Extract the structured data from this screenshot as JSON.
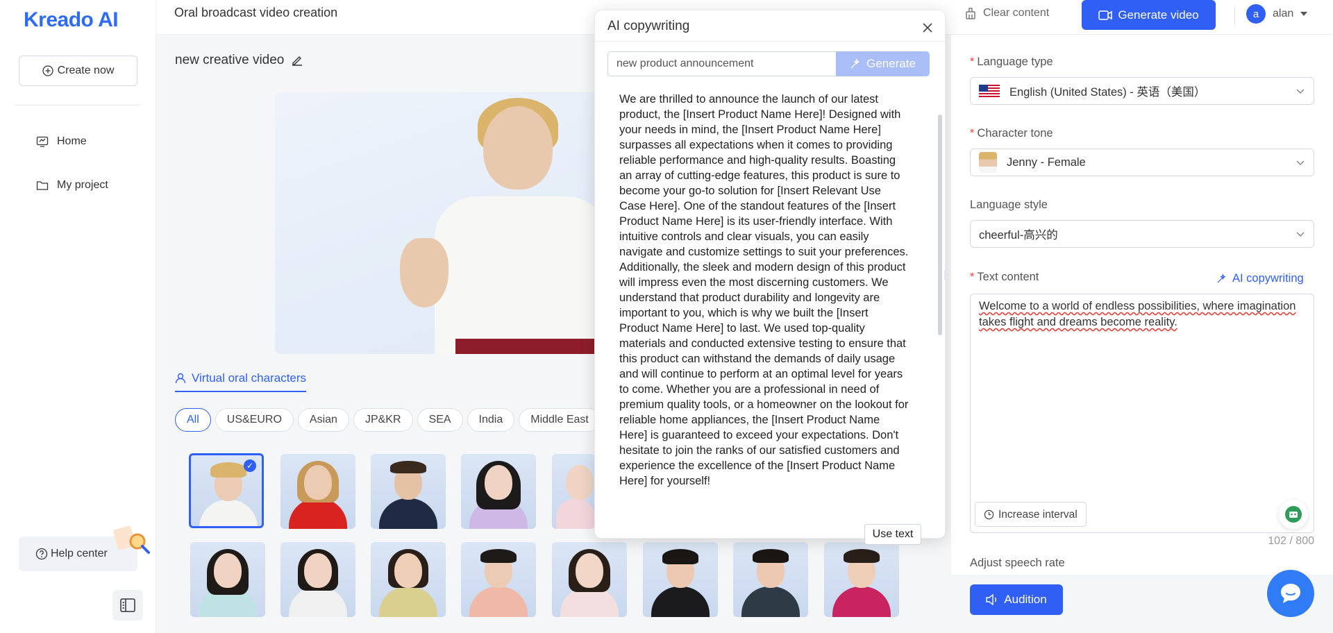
{
  "sidebar": {
    "logo": "Kreado AI",
    "create_label": "Create now",
    "nav": [
      {
        "label": "Home",
        "icon": "home-icon"
      },
      {
        "label": "My project",
        "icon": "folder-icon"
      }
    ],
    "help_label": "Help center"
  },
  "header": {
    "title": "Oral broadcast video creation",
    "clear_label": "Clear content",
    "generate_label": "Generate video",
    "user_initial": "a",
    "user_name": "alan"
  },
  "main": {
    "video_name": "new creative video",
    "tab_label": "Virtual oral characters",
    "filters": [
      "All",
      "US&EURO",
      "Asian",
      "JP&KR",
      "SEA",
      "India",
      "Middle East"
    ],
    "active_filter": "All"
  },
  "popup": {
    "title": "AI copywriting",
    "prompt_value": "new product announcement",
    "generate_label": "Generate",
    "generated_text": "We are thrilled to announce the launch of our latest product, the [Insert Product Name Here]! Designed with your needs in mind, the [Insert Product Name Here] surpasses all expectations when it comes to providing reliable performance and high-quality results. Boasting an array of cutting-edge features, this product is sure to become your go-to solution for [Insert Relevant Use Case Here]. One of the standout features of the [Insert Product Name Here] is its user-friendly interface. With intuitive controls and clear visuals, you can easily navigate and customize settings to suit your preferences. Additionally, the sleek and modern design of this product will impress even the most discerning customers. We understand that product durability and longevity are important to you, which is why we built the [Insert Product Name Here] to last. We used top-quality materials and conducted extensive testing to ensure that this product can withstand the demands of daily usage and will continue to perform at an optimal level for years to come. Whether you are a professional in need of premium quality tools, or a homeowner on the lookout for reliable home appliances, the [Insert Product Name Here] is guaranteed to exceed your expectations. Don't hesitate to join the ranks of our satisfied customers and experience the excellence of the [Insert Product Name Here] for yourself!",
    "use_text_label": "Use text"
  },
  "settings": {
    "language_type_label": "Language type",
    "language_type_value": "English (United States) - 英语（美国）",
    "character_tone_label": "Character tone",
    "character_tone_value": "Jenny - Female",
    "language_style_label": "Language style",
    "language_style_value": "cheerful-高兴的",
    "text_content_label": "Text content",
    "ai_copy_link": "AI copywriting",
    "text_content_value": "Welcome to a world of endless possibilities, where imagination takes flight and dreams become reality.",
    "interval_label": "Increase interval",
    "counter": "102 / 800",
    "speech_rate_label": "Adjust speech rate",
    "audition_label": "Audition"
  },
  "colors": {
    "accent": "#2f5ff5",
    "required": "#f0453a"
  }
}
